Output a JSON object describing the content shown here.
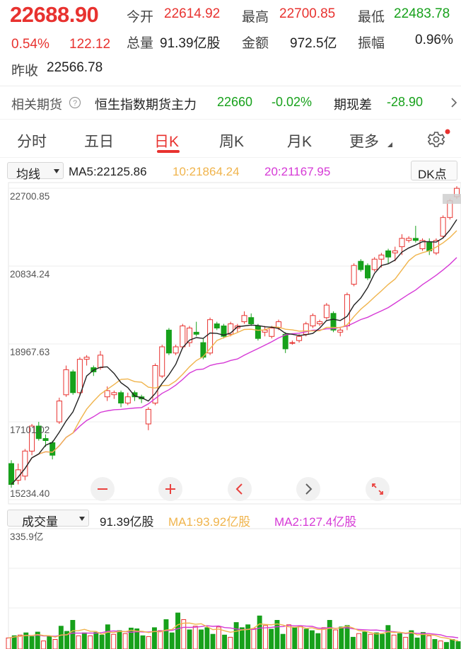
{
  "quote": {
    "price": "22688.90",
    "change_pct": "0.54%",
    "change": "122.12",
    "open_label": "今开",
    "open": "22614.92",
    "high_label": "最高",
    "high": "22700.85",
    "low_label": "最低",
    "low": "22483.78",
    "volume_label": "总量",
    "volume": "91.39亿股",
    "amount_label": "金额",
    "amount": "972.5亿",
    "amplitude_label": "振幅",
    "amplitude": "0.96%",
    "prev_close_label": "昨收",
    "prev_close": "22566.78"
  },
  "futures": {
    "label": "相关期货",
    "help_icon": "question-circle-icon",
    "name": "恒生指数期货主力",
    "price": "22660",
    "change_pct": "-0.02%",
    "basis_label": "期现差",
    "basis": "-28.90",
    "chevron_icon": "chevron-right-icon"
  },
  "tabs": [
    "分时",
    "五日",
    "日K",
    "周K",
    "月K",
    "更多"
  ],
  "active_tab": "日K",
  "settings_icon": "gear-icon",
  "ma_bar": {
    "mode": "均线",
    "ma5": "MA5:22125.86",
    "ma10": "10:21864.24",
    "ma20": "20:21167.95",
    "dk_button": "DK点"
  },
  "price_axis": [
    "22700.85",
    "20834.24",
    "18967.63",
    "17101.02",
    "15234.40"
  ],
  "controls": [
    "zoom-out-icon",
    "zoom-in-icon",
    "chevron-left-icon",
    "chevron-right-icon",
    "fullscreen-icon"
  ],
  "volume_bar": {
    "mode": "成交量",
    "value": "91.39亿股",
    "ma1": "MA1:93.92亿股",
    "ma2": "MA2:127.4亿股",
    "axis_max": "335.9亿"
  },
  "colors": {
    "up": "#e8322f",
    "down": "#17a11b",
    "ma5": "#222222",
    "ma10": "#f0b44c",
    "ma20": "#d63ad6"
  },
  "chart_data": {
    "type": "candlestick",
    "ylim": [
      15234.4,
      22700.85
    ],
    "candles": [
      [
        16100,
        15600,
        16180,
        15520
      ],
      [
        15700,
        15950,
        16100,
        15600
      ],
      [
        15800,
        16400,
        16450,
        15700
      ],
      [
        16400,
        17000,
        17050,
        16300
      ],
      [
        17000,
        16700,
        17100,
        16650
      ],
      [
        16700,
        16650,
        16800,
        16500
      ],
      [
        16600,
        16300,
        16650,
        16200
      ],
      [
        17100,
        17600,
        17680,
        17050
      ],
      [
        17750,
        18350,
        18450,
        17700
      ],
      [
        18300,
        17800,
        18350,
        17750
      ],
      [
        17800,
        18600,
        18650,
        17750
      ],
      [
        18600,
        18650,
        18700,
        18450
      ],
      [
        18400,
        18300,
        18450,
        18200
      ],
      [
        18400,
        18700,
        18800,
        18350
      ],
      [
        17700,
        17850,
        17950,
        17600
      ],
      [
        17750,
        17800,
        17850,
        17650
      ],
      [
        17800,
        17550,
        17850,
        17450
      ],
      [
        17550,
        17700,
        17800,
        17500
      ],
      [
        17800,
        17700,
        17850,
        17600
      ],
      [
        17700,
        17650,
        17750,
        17550
      ],
      [
        17050,
        17400,
        17450,
        16900
      ],
      [
        17550,
        18450,
        18500,
        17500
      ],
      [
        18200,
        18900,
        18950,
        18150
      ],
      [
        19300,
        18750,
        19350,
        18700
      ],
      [
        18750,
        18900,
        18950,
        18700
      ],
      [
        18900,
        19400,
        19450,
        18850
      ],
      [
        19000,
        19350,
        19400,
        18900
      ],
      [
        19250,
        19200,
        19500,
        19150
      ],
      [
        19000,
        18650,
        19100,
        18600
      ],
      [
        18750,
        19550,
        19600,
        18700
      ],
      [
        19450,
        19350,
        19500,
        19300
      ],
      [
        19400,
        19150,
        19450,
        19100
      ],
      [
        19200,
        19450,
        19500,
        19150
      ],
      [
        19350,
        19400,
        19450,
        19250
      ],
      [
        19500,
        19650,
        19750,
        19450
      ],
      [
        19600,
        19450,
        19700,
        19400
      ],
      [
        19400,
        19100,
        19450,
        19050
      ],
      [
        19250,
        19300,
        19400,
        19150
      ],
      [
        19150,
        19350,
        19400,
        19100
      ],
      [
        19350,
        19500,
        19550,
        19300
      ],
      [
        19200,
        18850,
        19250,
        18750
      ],
      [
        19000,
        19000,
        19050,
        18950
      ],
      [
        19050,
        19150,
        19200,
        19000
      ],
      [
        19200,
        19450,
        19500,
        19150
      ],
      [
        19400,
        19650,
        19700,
        19350
      ],
      [
        19450,
        19500,
        19550,
        19400
      ],
      [
        19600,
        19900,
        19950,
        19550
      ],
      [
        19700,
        19300,
        19750,
        19250
      ],
      [
        19250,
        19300,
        19350,
        19150
      ],
      [
        19400,
        20150,
        20200,
        19300
      ],
      [
        20400,
        20850,
        20900,
        20350
      ],
      [
        20950,
        20750,
        21000,
        20700
      ],
      [
        20850,
        20550,
        20900,
        20500
      ],
      [
        20750,
        21000,
        21050,
        20700
      ],
      [
        21000,
        21100,
        21150,
        20800
      ],
      [
        21200,
        21050,
        21250,
        20900
      ],
      [
        21150,
        21200,
        21300,
        20950
      ],
      [
        21300,
        21500,
        21600,
        21100
      ],
      [
        21450,
        21500,
        21550,
        21400
      ],
      [
        21500,
        21450,
        21800,
        21400
      ],
      [
        21250,
        21450,
        21500,
        21200
      ],
      [
        21400,
        21200,
        21500,
        21100
      ],
      [
        21150,
        21450,
        21500,
        21100
      ],
      [
        21550,
        22000,
        22050,
        21500
      ],
      [
        22000,
        22400,
        22450,
        21950
      ],
      [
        22500,
        22700,
        22750,
        22450
      ]
    ],
    "volumes": [
      30,
      36,
      38,
      44,
      34,
      46,
      22,
      35,
      26,
      62,
      48,
      78,
      36,
      44,
      36,
      45,
      38,
      66,
      40,
      50,
      42,
      57,
      55,
      36,
      34,
      58,
      50,
      80,
      44,
      98,
      80,
      52,
      62,
      52,
      58,
      40,
      60,
      38,
      32,
      72,
      58,
      66,
      56,
      90,
      64,
      54,
      78,
      40,
      66,
      58,
      62,
      54,
      50,
      42,
      58,
      78,
      52,
      60,
      64,
      32,
      42,
      46,
      40,
      44,
      40,
      64,
      38,
      42,
      32,
      50,
      30,
      45,
      36,
      26,
      22,
      18,
      26,
      20
    ],
    "vol_ylim": [
      0,
      335.9
    ]
  }
}
